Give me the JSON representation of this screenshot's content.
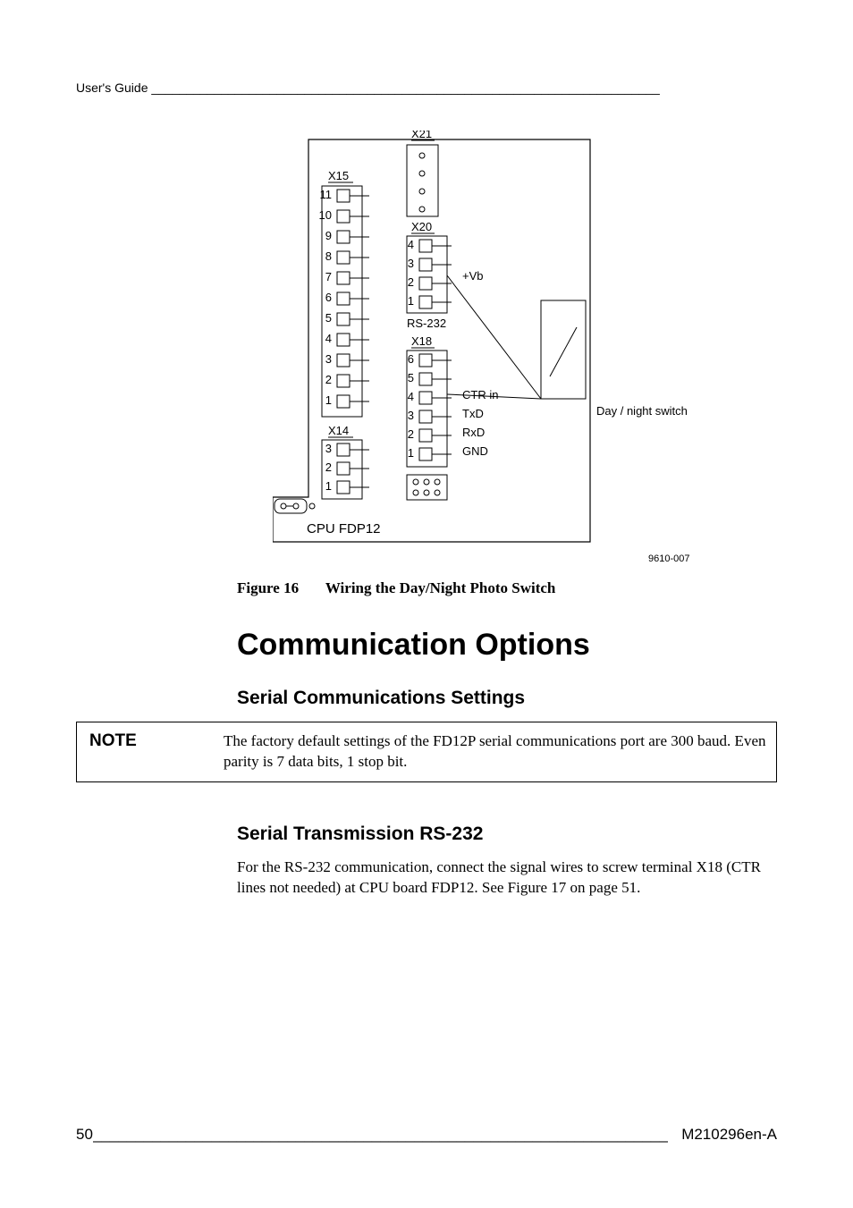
{
  "header": {
    "text": "User's Guide _________________________________________________________________________"
  },
  "figure": {
    "label_x21": "X21",
    "label_x20": "X20",
    "label_x18": "X18",
    "label_x15": "X15",
    "label_x14": "X14",
    "label_rs232": "RS-232",
    "label_vb": "+Vb",
    "label_ctr_in": "CTR in",
    "label_txd": "TxD",
    "label_rxd": "RxD",
    "label_gnd": "GND",
    "label_cpu": "CPU FDP12",
    "label_switch": "Day / night switch",
    "image_code": "9610-007",
    "x15_nums": [
      "11",
      "10",
      "9",
      "8",
      "7",
      "6",
      "5",
      "4",
      "3",
      "2",
      "1"
    ],
    "x20_nums": [
      "4",
      "3",
      "2",
      "1"
    ],
    "x18_nums": [
      "6",
      "5",
      "4",
      "3",
      "2",
      "1"
    ],
    "x14_nums": [
      "3",
      "2",
      "1"
    ]
  },
  "caption": {
    "prefix": "Figure 16",
    "title": "Wiring the Day/Night Photo Switch"
  },
  "sections": {
    "h1": "Communication Options",
    "h2a": "Serial Communications Settings",
    "h2b": "Serial Transmission RS-232"
  },
  "note": {
    "label": "NOTE",
    "text": "The factory default settings of the FD12P serial communications port are 300 baud. Even parity is 7 data bits, 1 stop bit."
  },
  "para1": "For the RS-232 communication, connect the signal wires to screw terminal X18 (CTR lines not needed) at CPU board FDP12. See Figure 17 on page 51.",
  "footer": {
    "page": "50",
    "fill": "____________________________________________________________________",
    "doc": " M210296en-A"
  }
}
